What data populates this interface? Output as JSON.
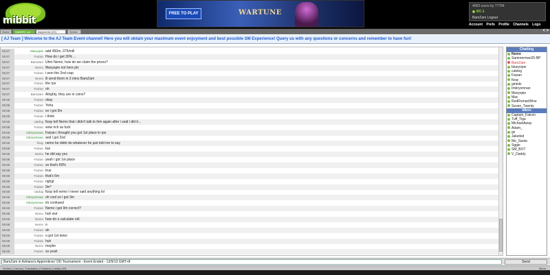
{
  "logo": {
    "text": "mibbit"
  },
  "ad": {
    "button_label": "FREE TO PLAY",
    "title": "WARTUNE"
  },
  "userbox": {
    "line1": "4683 users  by  77784",
    "line2": "BC-1",
    "line3": "BamZam   Logout"
  },
  "topnav": [
    "Account",
    "Prefs",
    "Profile",
    "Channels",
    "Logo"
  ],
  "tabs": [
    {
      "label": "Home"
    },
    {
      "label": "SwiftIRC_se"
    },
    {
      "label": "#apprentic (22)"
    },
    {
      "label": "Server"
    }
  ],
  "tab_arrows": "< >",
  "topic": "[ AJ Team ] Welcome to the AJ Team Event channel! Here you will obtain your maximum event enjoyment and best possible SM Experience!  Query us with any questions or concerns and remember to have fun!",
  "chat": [
    {
      "time": "06:57",
      "nick": "Maxyspie",
      "msg": "add 450m..375/mill"
    },
    {
      "time": "06:57",
      "nick": "Faizan",
      "msg": "How do i get 30% ..."
    },
    {
      "time": "06:57",
      "nick": "BamZam",
      "msg": "Uhm Nemo, how do we claim the prizes?"
    },
    {
      "time": "06:57",
      "nick": "Nemo",
      "msg": "Maxyspie not here plz"
    },
    {
      "time": "06:57",
      "nick": "Faizan",
      "msg": "i won the 2nd crap"
    },
    {
      "time": "06:57",
      "nick": "Nemo",
      "msg": "ill send them in 3 mins BamZam"
    },
    {
      "time": "06:57",
      "nick": "Faizan",
      "msg": "the rps"
    },
    {
      "time": "06:57",
      "nick": "Faizan",
      "msg": "oh"
    },
    {
      "time": "06:57",
      "nick": "BamZam",
      "msg": "Alrighty, they are in coins?"
    },
    {
      "time": "06:58",
      "nick": "Faizan",
      "msg": "okay"
    },
    {
      "time": "06:58",
      "nick": "Faizan",
      "msg": "Yeha"
    },
    {
      "time": "06:58",
      "nick": "Faizan",
      "msg": "so i got 3m"
    },
    {
      "time": "06:58",
      "nick": "Faizan",
      "msg": "i think"
    },
    {
      "time": "06:58",
      "nick": "catdog",
      "msg": "fizay tell Nemo that i didn't talk to him again after i said i did it..."
    },
    {
      "time": "06:58",
      "nick": "Faizan",
      "msg": "wow rich as fuck"
    },
    {
      "time": "06:58",
      "nick": "Imbrysmnan",
      "msg": "Faizan i thought you got 1st place in rps"
    },
    {
      "time": "06:58",
      "nick": "Imbrysmnan",
      "msg": "and i got 2nd"
    },
    {
      "time": "06:58",
      "nick": "fizay",
      "msg": "nemo he didnt do whatever he just told me to say"
    },
    {
      "time": "06:58",
      "nick": "Faizan",
      "msg": "but"
    },
    {
      "time": "06:58",
      "nick": "Nemo",
      "msg": "he did say yes"
    },
    {
      "time": "06:58",
      "nick": "Faizan",
      "msg": "yeah i got 1st place"
    },
    {
      "time": "06:58",
      "nick": "Faizan",
      "msg": "so that's 60%"
    },
    {
      "time": "06:58",
      "nick": "Faizan",
      "msg": "true"
    },
    {
      "time": "06:58",
      "nick": "Faizan",
      "msg": "that's 6m"
    },
    {
      "time": "06:58",
      "nick": "Faizan",
      "msg": "righgt"
    },
    {
      "time": "06:58",
      "nick": "Faizan",
      "msg": "9m*"
    },
    {
      "time": "06:58",
      "nick": "catdog",
      "msg": "fizay tell nemo I never said anything lol"
    },
    {
      "time": "06:58",
      "nick": "Imbrysmnan",
      "msg": "oh cool so i got 3m"
    },
    {
      "time": "06:58",
      "nick": "Imbrysmnan",
      "msg": "im confused"
    },
    {
      "time": "06:58",
      "nick": "Faizan",
      "msg": "Nemo i get 9m correct?"
    },
    {
      "time": "06:58",
      "nick": "Nemo",
      "msg": "huh wut"
    },
    {
      "time": "06:58",
      "nick": "Nemo",
      "msg": "how do u calculate roll."
    },
    {
      "time": "06:58",
      "nick": "Nemo",
      "msg": "o"
    },
    {
      "time": "06:58",
      "nick": "Faizan",
      "msg": "ah"
    },
    {
      "time": "06:59",
      "nick": "Faizan",
      "msg": "u got 1st twice"
    },
    {
      "time": "06:59",
      "nick": "Faizan",
      "msg": "huh"
    },
    {
      "time": "06:59",
      "nick": "Nemo",
      "msg": "maybe"
    },
    {
      "time": "06:59",
      "nick": "Faizan",
      "msg": "so yeah"
    }
  ],
  "sidebar": {
    "chatting_label": "Chatting",
    "chatting": [
      {
        "name": "Nemo",
        "style": "bold"
      },
      {
        "name": "Sammerman25-BP",
        "style": ""
      },
      {
        "name": "BamZam",
        "style": "red"
      },
      {
        "name": "blueyojoe",
        "style": ""
      },
      {
        "name": "catdog",
        "style": ""
      },
      {
        "name": "Faizan",
        "style": ""
      },
      {
        "name": "fizay",
        "style": ""
      },
      {
        "name": "gintoki",
        "style": ""
      },
      {
        "name": "Imbrysmnan",
        "style": ""
      },
      {
        "name": "Maxyspie",
        "style": ""
      },
      {
        "name": "Mac",
        "style": ""
      },
      {
        "name": "RedRomanWine",
        "style": ""
      },
      {
        "name": "Seven_Twenty",
        "style": ""
      }
    ],
    "idlers_label": "Idlers",
    "idlers": [
      {
        "name": "Captain_Falcon"
      },
      {
        "name": "Tuff_Tiga"
      },
      {
        "name": "MichaelAway"
      },
      {
        "name": "Adam_"
      },
      {
        "name": "gz"
      },
      {
        "name": "Jakeitsd"
      },
      {
        "name": "Mo_Santa"
      },
      {
        "name": "Sggle"
      },
      {
        "name": "SM_BOT"
      },
      {
        "name": "V_Daddy"
      }
    ]
  },
  "input": {
    "value": "BamZam in Adriana's Apprentices' DD Tournament - Event Ended - 13/9/13 GMT+8",
    "send_label": "Send"
  },
  "statusbar": {
    "left": "Smiles | Colours | Translation | Pastebin | Notify URL",
    "right": "Menu"
  },
  "colors": {
    "topic_text": "#1a5ad8",
    "nick_green": "#2f8f2f",
    "sidebar_header": "#5b7dbd",
    "highlight_nick": "#d63a3a"
  }
}
